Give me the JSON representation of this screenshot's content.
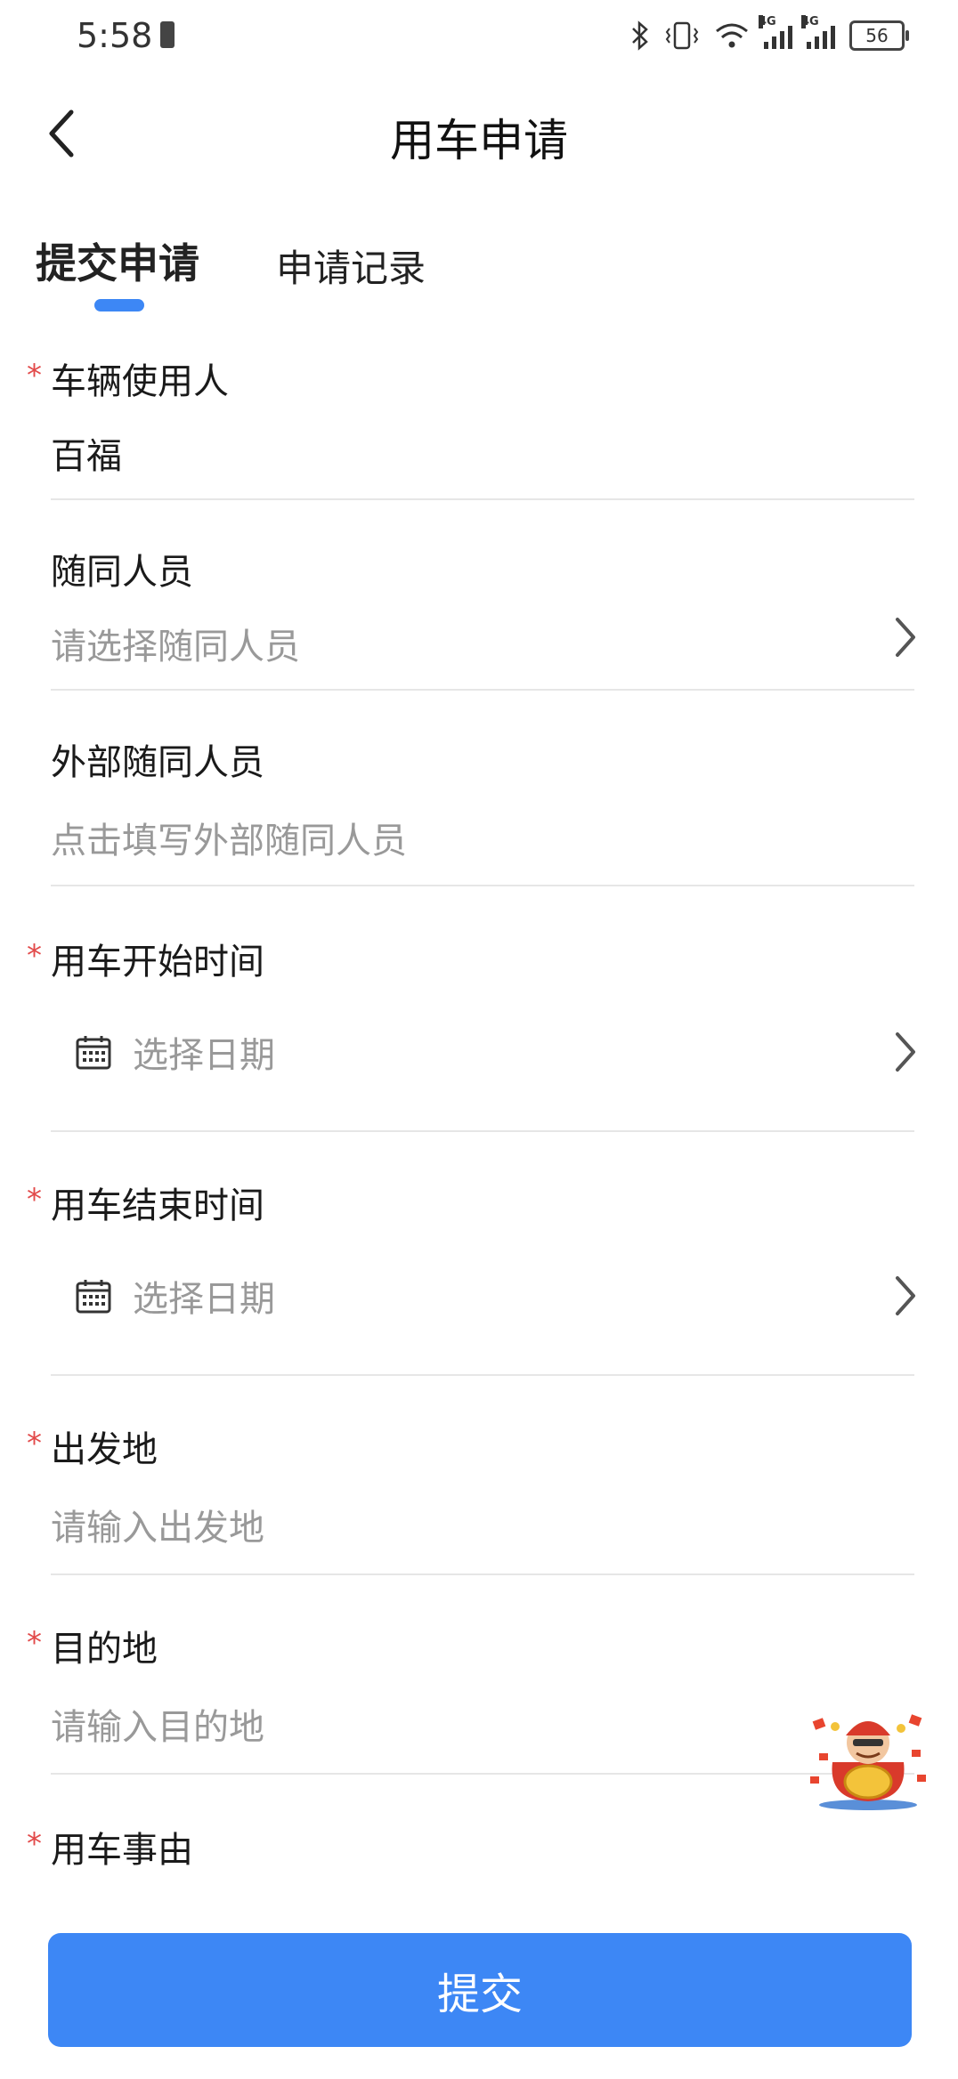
{
  "status_bar": {
    "time": "5:58",
    "network_1": "4G",
    "network_2": "4G",
    "battery": "56"
  },
  "nav": {
    "title": "用车申请",
    "back_icon": "chevron-left-icon"
  },
  "tabs": [
    {
      "label": "提交申请",
      "active": true
    },
    {
      "label": "申请记录",
      "active": false
    }
  ],
  "form": {
    "user": {
      "required": true,
      "label": "车辆使用人",
      "value": "百福"
    },
    "companions": {
      "required": false,
      "label": "随同人员",
      "placeholder": "请选择随同人员"
    },
    "external_companions": {
      "required": false,
      "label": "外部随同人员",
      "placeholder": "点击填写外部随同人员"
    },
    "start_time": {
      "required": true,
      "label": "用车开始时间",
      "placeholder": "选择日期",
      "icon": "calendar-icon"
    },
    "end_time": {
      "required": true,
      "label": "用车结束时间",
      "placeholder": "选择日期",
      "icon": "calendar-icon"
    },
    "departure": {
      "required": true,
      "label": "出发地",
      "placeholder": "请输入出发地"
    },
    "destination": {
      "required": true,
      "label": "目的地",
      "placeholder": "请输入目的地"
    },
    "reason": {
      "required": true,
      "label": "用车事由"
    }
  },
  "required_mark": "*",
  "submit_label": "提交",
  "colors": {
    "accent": "#3d87f5",
    "required": "#e24a4a",
    "placeholder": "#999999",
    "divider": "#e6e6e6"
  }
}
